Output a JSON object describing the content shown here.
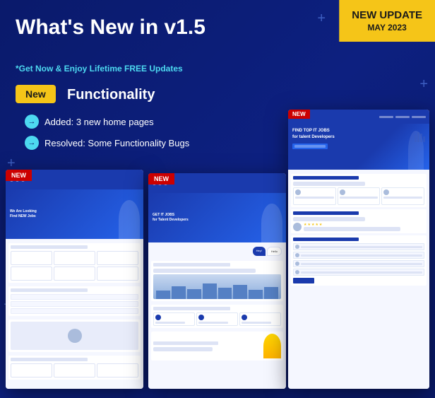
{
  "badge": {
    "update_title": "NEW UPDATE",
    "update_date": "MAY 2023"
  },
  "heading": {
    "main": "What's New in v1.5",
    "sub": "*Get Now & Enjoy Lifetime FREE Updates"
  },
  "section": {
    "new_label": "New",
    "functionality_label": "Functionality",
    "bullet1": "Added: 3 new home pages",
    "bullet2": "Resolved: Some Functionality Bugs"
  },
  "decorative": {
    "plus_char": "+"
  },
  "ribbon": {
    "new_text": "NEW"
  }
}
